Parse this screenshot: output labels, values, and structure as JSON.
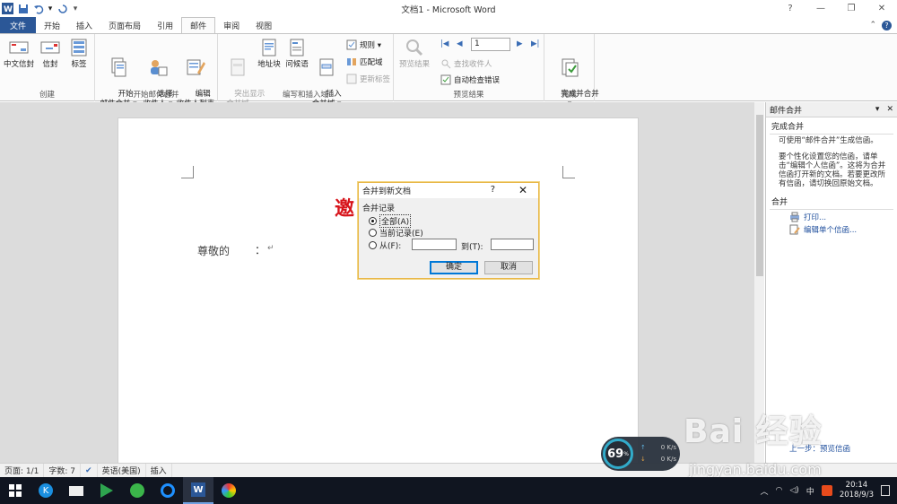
{
  "titlebar": {
    "title": "文档1 - Microsoft Word"
  },
  "tabs": [
    {
      "label": "文件"
    },
    {
      "label": "开始"
    },
    {
      "label": "插入"
    },
    {
      "label": "页面布局"
    },
    {
      "label": "引用"
    },
    {
      "label": "邮件"
    },
    {
      "label": "审阅"
    },
    {
      "label": "视图"
    }
  ],
  "ribbon": {
    "create": {
      "label": "创建",
      "buttons": [
        "中文信封",
        "信封",
        "标签"
      ]
    },
    "start_merge": {
      "label": "开始邮件合并",
      "buttons": [
        "开始\n邮件合并 ▾",
        "选择\n收件人 ▾",
        "编辑\n收件人列表"
      ]
    },
    "write_insert": {
      "label": "编写和插入域",
      "buttons": [
        "突出显示\n合并域",
        "地址块",
        "问候语",
        "插入\n合并域 ▾"
      ],
      "small": [
        "规则 ▾",
        "匹配域",
        "更新标签"
      ]
    },
    "preview": {
      "label": "预览结果",
      "preview_button": "预览结果",
      "record_value": "1",
      "small": [
        "查找收件人",
        "自动检查错误"
      ]
    },
    "finish": {
      "label": "完成",
      "button": "完成并合并\n▾"
    }
  },
  "document": {
    "greeting": "尊敬的",
    "colon": "：",
    "return_mark": "↵",
    "red_text": "邀"
  },
  "dialog": {
    "title": "合并到新文档",
    "help": "?",
    "close": "✕",
    "legend": "合并记录",
    "options": [
      "全部(A)",
      "当前记录(E)",
      "从(F):"
    ],
    "to_label": "到(T):",
    "ok": "确定",
    "cancel": "取消"
  },
  "taskpane": {
    "title": "邮件合并",
    "section1": "完成合并",
    "text1": "可使用“邮件合并”生成信函。",
    "text2": "要个性化设置您的信函，请单击“编辑个人信函”。这将为合并信函打开新的文档。若要更改所有信函，请切换回原始文档。",
    "section2": "合并",
    "link_print": "打印...",
    "link_edit": "编辑单个信函...",
    "bottom_link": "上一步：预览信函"
  },
  "status": {
    "page": "页面: 1/1",
    "words": "字数: 7",
    "lang": "英语(美国)",
    "mode": "插入"
  },
  "speed": {
    "percent": "69",
    "unit": "%",
    "up": "0 K/s",
    "down": "0 K/s"
  },
  "watermark": {
    "text1": "Bai 经验",
    "text2": "jingyan.baidu.com"
  },
  "taskbar": {
    "ime": "中",
    "time": "20:14",
    "date": "2018/9/3"
  }
}
